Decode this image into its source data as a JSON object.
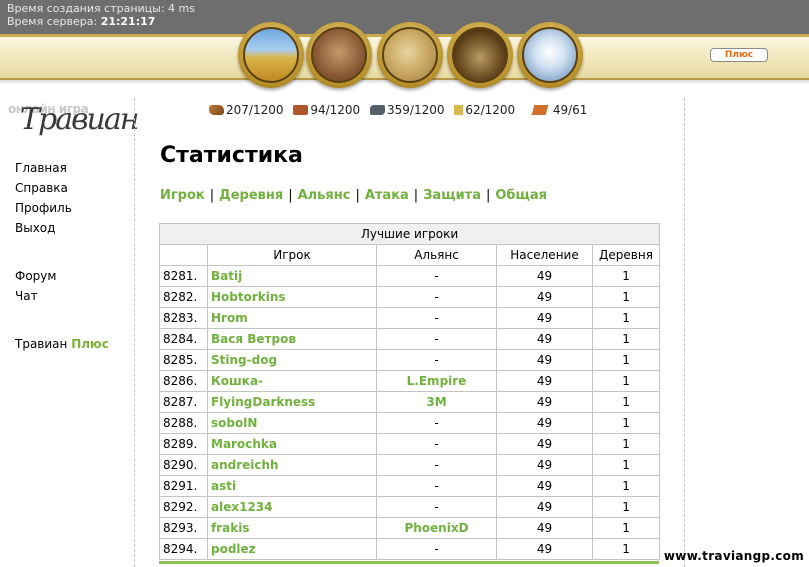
{
  "info": {
    "gen_label": "Время создания страницы:",
    "gen_value": "4 ms",
    "server_label": "Время сервера:",
    "server_value": "21:21:17"
  },
  "header": {
    "plus_button": "Плюс",
    "medallions": [
      "village-overview-icon",
      "village-center-icon",
      "map-icon",
      "statistics-icon",
      "reports-icon"
    ]
  },
  "logo": {
    "sub": "онлайн игра",
    "main": "Травиан"
  },
  "nav": {
    "items": [
      "Главная",
      "Справка",
      "Профиль",
      "Выход"
    ],
    "items2": [
      "Форум",
      "Чат"
    ],
    "travian_label": "Травиан",
    "plus_label": "Плюс"
  },
  "resources": [
    {
      "icon": "wood-icon",
      "value": "207/1200"
    },
    {
      "icon": "clay-icon",
      "value": "94/1200"
    },
    {
      "icon": "iron-icon",
      "value": "359/1200"
    },
    {
      "icon": "crop-icon",
      "value": "62/1200"
    },
    {
      "icon": "consumption-icon",
      "value": "49/61"
    }
  ],
  "page": {
    "title": "Статистика",
    "tabs": [
      "Игрок",
      "Деревня",
      "Альянс",
      "Атака",
      "Защита",
      "Общая"
    ]
  },
  "table": {
    "caption": "Лучшие игроки",
    "columns": [
      "",
      "Игрок",
      "Альянс",
      "Население",
      "Деревня"
    ],
    "rows": [
      [
        "8281.",
        "Batij",
        "-",
        "49",
        "1"
      ],
      [
        "8282.",
        "Hobtorkins",
        "-",
        "49",
        "1"
      ],
      [
        "8283.",
        "Hrom",
        "-",
        "49",
        "1"
      ],
      [
        "8284.",
        "Вася Ветров",
        "-",
        "49",
        "1"
      ],
      [
        "8285.",
        "Sting-dog",
        "-",
        "49",
        "1"
      ],
      [
        "8286.",
        "Кошка-",
        "L.Empire",
        "49",
        "1"
      ],
      [
        "8287.",
        "FlyingDarkness",
        "3M",
        "49",
        "1"
      ],
      [
        "8288.",
        "sobolN",
        "-",
        "49",
        "1"
      ],
      [
        "8289.",
        "Marochka",
        "-",
        "49",
        "1"
      ],
      [
        "8290.",
        "andreichh",
        "-",
        "49",
        "1"
      ],
      [
        "8291.",
        "asti",
        "-",
        "49",
        "1"
      ],
      [
        "8292.",
        "alex1234",
        "-",
        "49",
        "1"
      ],
      [
        "8293.",
        "frakis",
        "PhoenixD",
        "49",
        "1"
      ],
      [
        "8294.",
        "podlez",
        "-",
        "49",
        "1"
      ]
    ]
  },
  "watermark": "www.traviangp.com"
}
